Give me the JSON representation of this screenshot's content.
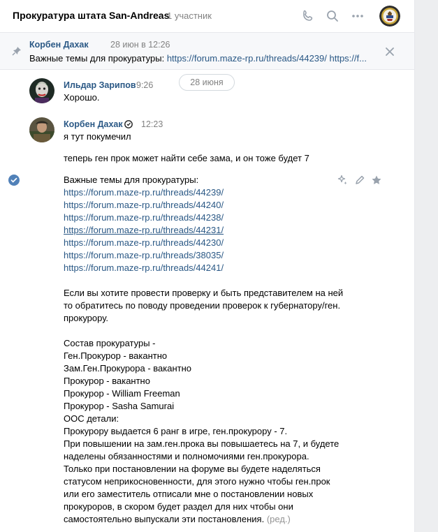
{
  "header": {
    "title": "Прокуратура штата San-Andreas",
    "members": "1 участник",
    "icons": [
      "phone-icon",
      "search-icon",
      "more-icon"
    ]
  },
  "pinned": {
    "author": "Корбен Дахак",
    "date": "28 июн в 12:26",
    "text_prefix": "Важные темы для прокуратуры: ",
    "text_links": "https://forum.maze-rp.ru/threads/44239/ https://f..."
  },
  "date_divider": "28 июня",
  "messages": [
    {
      "author": "Ильдар Зарипов",
      "time": "9:26",
      "text": "Хорошо."
    },
    {
      "author": "Корбен Дахак",
      "time": "12:23",
      "line1": "я тут покумечил",
      "line2": "теперь ген прок может найти себе зама, и он тоже будет 7",
      "topics_title": "Важные темы для прокуратуры:",
      "links": [
        "https://forum.maze-rp.ru/threads/44239/",
        "https://forum.maze-rp.ru/threads/44240/",
        "https://forum.maze-rp.ru/threads/44238/",
        "https://forum.maze-rp.ru/threads/44231/",
        "https://forum.maze-rp.ru/threads/44230/",
        "https://forum.maze-rp.ru/threads/38035/",
        "https://forum.maze-rp.ru/threads/44241/"
      ],
      "para1": [
        "Если вы хотите провести проверку и быть представителем на ней",
        "то обратитесь по поводу проведении проверок к губернатору/ген.",
        "прокурору."
      ],
      "staff": [
        "Состав прокуратуры -",
        "Ген.Прокурор - вакантно",
        "Зам.Ген.Прокурора - вакантно",
        "Прокурор - вакантно",
        "Прокурор - William Freeman",
        "Прокурор - Sasha Samurai",
        "ООС детали:",
        "Прокурору выдается 6 ранг в игре, ген.прокурору - 7.",
        "При повышении на зам.ген.прока вы повышаетесь на 7, и будете",
        "наделены обязанностями и полномочиями ген.прокурора.",
        "Только при постановлении на форуме вы будете наделяться",
        "статусом неприкосновенности, для этого нужно чтобы ген.прок",
        "или его заместитель отписали мне о постановлении новых",
        "прокуроров, в скором будет раздел для них чтобы они"
      ],
      "last_line": "самостоятельно выпускали эти постановления.",
      "edited": "(ред.)"
    }
  ]
}
